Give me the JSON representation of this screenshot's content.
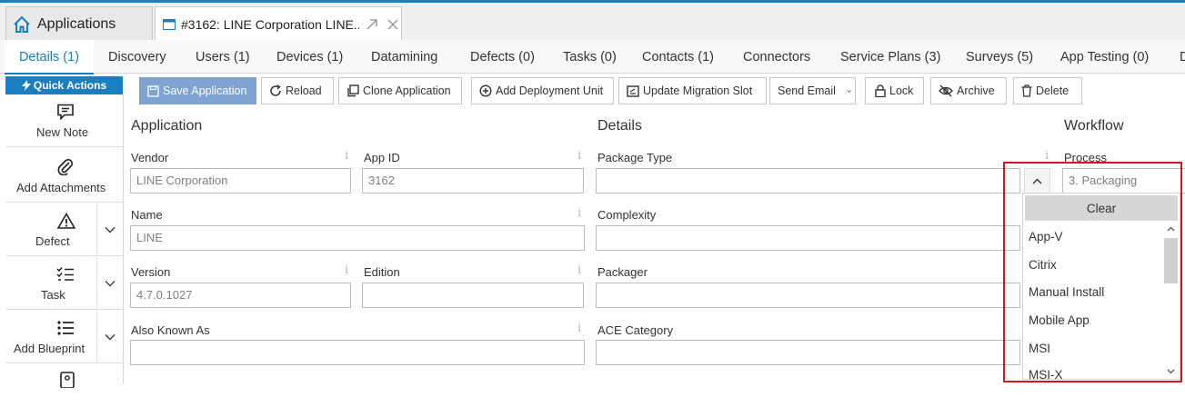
{
  "window_tabs": [
    {
      "label": "Applications",
      "icon": "home-icon"
    },
    {
      "label": "#3162: LINE Corporation LINE...",
      "icon": "window-icon"
    }
  ],
  "main_tabs": [
    "Details (1)",
    "Discovery",
    "Users (1)",
    "Devices (1)",
    "Datamining",
    "Defects (0)",
    "Tasks (0)",
    "Contacts (1)",
    "Connectors",
    "Service Plans (3)",
    "Surveys (5)",
    "App Testing (0)",
    "D"
  ],
  "quick_actions": {
    "title": "Quick Actions",
    "items": [
      {
        "label": "New  Note",
        "icon": "note-icon"
      },
      {
        "label": "Add  Attachments",
        "icon": "paperclip-icon"
      },
      {
        "label": "Defect",
        "icon": "warning-icon"
      },
      {
        "label": "Task",
        "icon": "checklist-icon"
      },
      {
        "label": "Add  Blueprint",
        "icon": "list-icon"
      }
    ]
  },
  "toolbar": {
    "save": "Save Application",
    "reload": "Reload",
    "clone": "Clone Application",
    "add_deployment": "Add Deployment Unit",
    "update_migration": "Update Migration Slot",
    "send_email": "Send Email",
    "lock": "Lock",
    "archive": "Archive",
    "delete": "Delete"
  },
  "sections": {
    "application": "Application",
    "details": "Details",
    "workflow": "Workflow"
  },
  "fields": {
    "vendor": {
      "label": "Vendor",
      "value": "LINE Corporation"
    },
    "app_id": {
      "label": "App ID",
      "value": "3162"
    },
    "name": {
      "label": "Name",
      "value": "LINE"
    },
    "version": {
      "label": "Version",
      "value": "4.7.0.1027"
    },
    "edition": {
      "label": "Edition",
      "value": ""
    },
    "also_known_as": {
      "label": "Also Known As",
      "value": ""
    },
    "package_type": {
      "label": "Package Type",
      "value": ""
    },
    "complexity": {
      "label": "Complexity",
      "value": ""
    },
    "packager": {
      "label": "Packager",
      "value": ""
    },
    "ace_category": {
      "label": "ACE Category",
      "value": ""
    },
    "process": {
      "label": "Process",
      "value": "3. Packaging"
    }
  },
  "dropdown": {
    "clear": "Clear",
    "options": [
      "App-V",
      "Citrix",
      "Manual Install",
      "Mobile App",
      "MSI",
      "MSI-X"
    ]
  },
  "info_glyph": "i",
  "colors": {
    "accent": "#1a7fc1",
    "highlight": "#d0191f",
    "primary_button": "#7ea3d0"
  }
}
